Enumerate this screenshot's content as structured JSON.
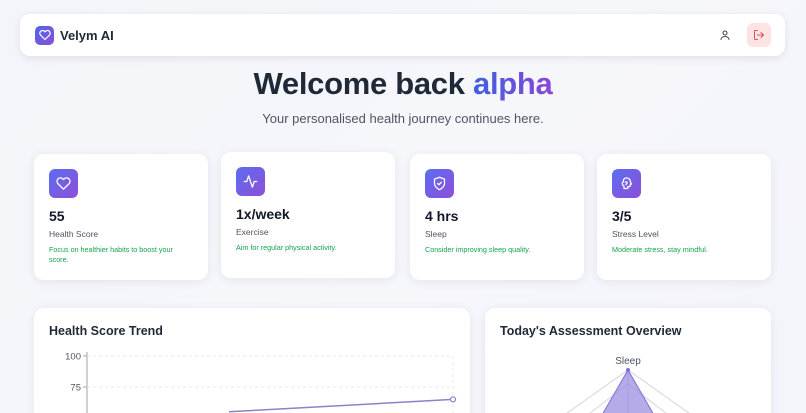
{
  "brand": {
    "name": "Velym AI",
    "accent_from": "#4f66e8",
    "accent_to": "#8a4fd8",
    "icon": "heart-icon"
  },
  "nav": {
    "profile_icon": "user-icon",
    "logout_icon": "logout-icon",
    "logout_bg": "#fde3e3"
  },
  "hero": {
    "greeting": "Welcome back",
    "username": "alpha",
    "subtitle": "Your personalised health journey continues here."
  },
  "stats": [
    {
      "icon": "heart-icon",
      "value": "55",
      "label": "Health Score",
      "note": "Focus on healthier habits to boost your score."
    },
    {
      "icon": "activity-icon",
      "value": "1x/week",
      "label": "Exercise",
      "note": "Aim for regular physical activity."
    },
    {
      "icon": "shield-icon",
      "value": "4 hrs",
      "label": "Sleep",
      "note": "Consider improving sleep quality."
    },
    {
      "icon": "brain-icon",
      "value": "3/5",
      "label": "Stress Level",
      "note": "Moderate stress, stay mindful."
    }
  ],
  "panels": {
    "trend_title": "Health Score Trend",
    "overview_title": "Today's Assessment Overview"
  },
  "chart_data": [
    {
      "type": "line",
      "title": "Health Score Trend",
      "yticks": [
        "100",
        "75"
      ],
      "ylim": [
        0,
        100
      ],
      "series": [
        {
          "values": [
            55,
            65
          ]
        }
      ],
      "grid": true,
      "color": "#8b83c9"
    },
    {
      "type": "radar",
      "title": "Today's Assessment Overview",
      "axes_visible": [
        "Sleep"
      ],
      "fill": "#9b8fe0"
    }
  ]
}
